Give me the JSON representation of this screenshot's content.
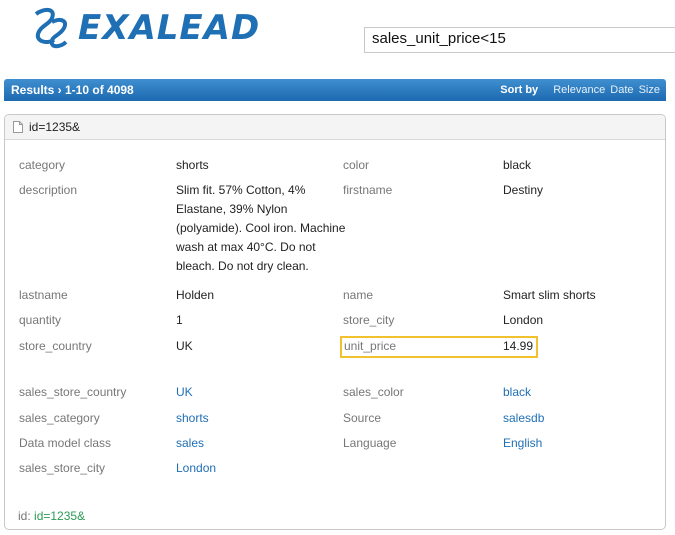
{
  "logo": {
    "text": "EXALEAD"
  },
  "search": {
    "value": "sales_unit_price<15"
  },
  "results": {
    "title": "Results › 1-10 of 4098",
    "sort_label": "Sort by",
    "sort_options": [
      "Relevance",
      "Date",
      "Size"
    ]
  },
  "record": {
    "title": "id=1235&",
    "fields": {
      "category": {
        "label": "category",
        "value": "shorts"
      },
      "color": {
        "label": "color",
        "value": "black"
      },
      "description": {
        "label": "description",
        "value": "Slim fit. 57% Cotton, 4% Elastane, 39% Nylon (polyamide). Cool iron. Machine wash at max 40°C. Do not bleach. Do not dry clean."
      },
      "firstname": {
        "label": "firstname",
        "value": "Destiny"
      },
      "lastname": {
        "label": "lastname",
        "value": "Holden"
      },
      "name": {
        "label": "name",
        "value": "Smart slim shorts"
      },
      "quantity": {
        "label": "quantity",
        "value": "1"
      },
      "store_city": {
        "label": "store_city",
        "value": "London"
      },
      "store_country": {
        "label": "store_country",
        "value": "UK"
      },
      "unit_price": {
        "label": "unit_price",
        "value": "14.99"
      }
    },
    "facets": {
      "sales_store_country": {
        "label": "sales_store_country",
        "value": "UK"
      },
      "sales_color": {
        "label": "sales_color",
        "value": "black"
      },
      "sales_category": {
        "label": "sales_category",
        "value": "shorts"
      },
      "source": {
        "label": "Source",
        "value": "salesdb"
      },
      "data_model_class": {
        "label": "Data model class",
        "value": "sales"
      },
      "language": {
        "label": "Language",
        "value": "English"
      },
      "sales_store_city": {
        "label": "sales_store_city",
        "value": "London"
      }
    },
    "id_label": "id:",
    "id_value": "id=1235&"
  }
}
